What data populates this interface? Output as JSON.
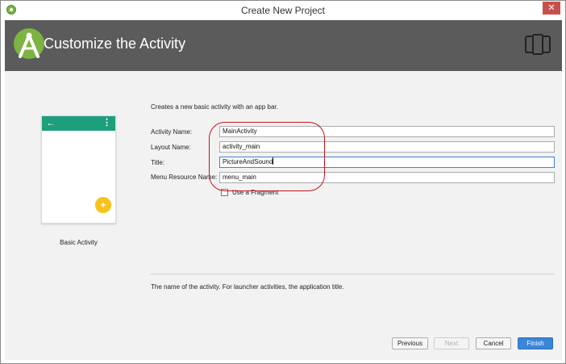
{
  "window": {
    "title": "Create New Project",
    "close_label": "✕"
  },
  "header": {
    "title": "Customize the Activity"
  },
  "preview": {
    "back_glyph": "←",
    "menu_glyph": "⋮",
    "fab_glyph": "+",
    "caption": "Basic Activity"
  },
  "form": {
    "description": "Creates a new basic activity with an app bar.",
    "fields": [
      {
        "label": "Activity Name:",
        "value": "MainActivity"
      },
      {
        "label": "Layout Name:",
        "value": "activity_main"
      },
      {
        "label": "Title:",
        "value": "PictureAndSound"
      },
      {
        "label": "Menu Resource Name:",
        "value": "menu_main"
      }
    ],
    "fragment_checkbox": {
      "label": "Use a Fragment",
      "checked": false
    }
  },
  "hint": "The name of the activity. For launcher activities, the application title.",
  "buttons": {
    "previous": "Previous",
    "next": "Next",
    "cancel": "Cancel",
    "finish": "Finish"
  },
  "colors": {
    "header_bg": "#5b5b5b",
    "appbar": "#1d9e7c",
    "fab": "#f7c21a",
    "primary_button": "#3c86d8",
    "annotation": "#c4141e",
    "close_button": "#c7514a"
  }
}
